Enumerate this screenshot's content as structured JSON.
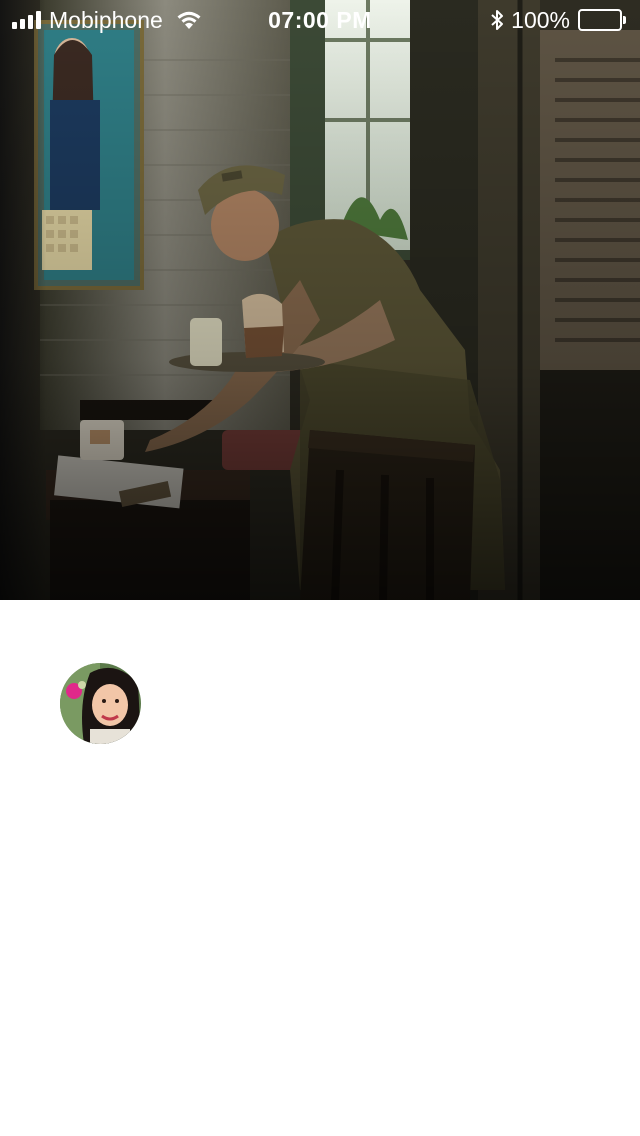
{
  "status_bar": {
    "carrier": "Mobiphone",
    "time": "07:00 PM",
    "battery_percent": "100%",
    "signal_bars": 4,
    "battery_level": 1.0,
    "icons": [
      "signal-icon",
      "wifi-icon",
      "bluetooth-icon",
      "battery-icon"
    ]
  },
  "hero": {
    "image": "cafe-waiter-photo"
  },
  "profile": {
    "avatar": "user-avatar-photo"
  },
  "colors": {
    "background": "#ffffff",
    "status_text": "#ffffff"
  }
}
